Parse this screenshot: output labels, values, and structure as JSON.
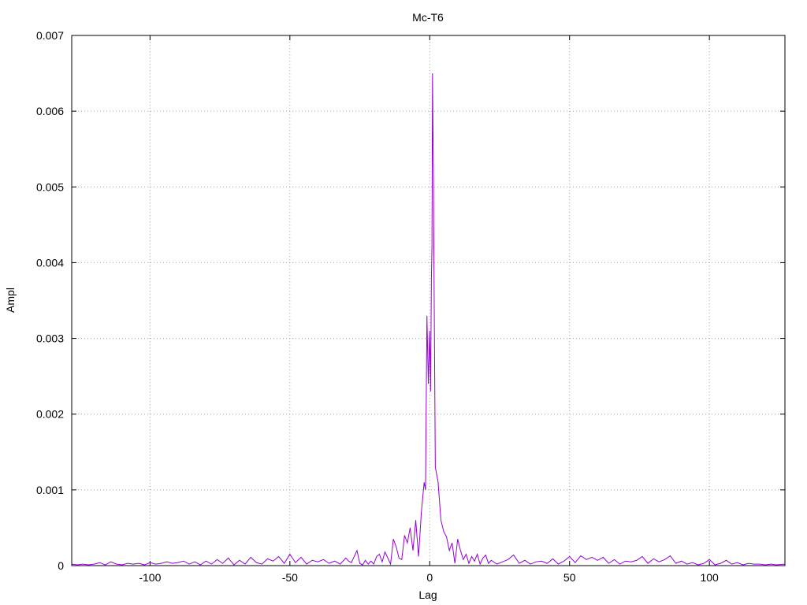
{
  "chart_data": {
    "type": "line",
    "title": "Mc-T6",
    "xlabel": "Lag",
    "ylabel": "Ampl",
    "xlim": [
      -128,
      127
    ],
    "ylim": [
      0,
      0.007
    ],
    "xticks": [
      -100,
      -50,
      0,
      50,
      100
    ],
    "xtick_labels": [
      "-100",
      "-50",
      "0",
      "50",
      "100"
    ],
    "yticks": [
      0,
      0.001,
      0.002,
      0.003,
      0.004,
      0.005,
      0.006,
      0.007
    ],
    "ytick_labels": [
      "0",
      "0.001",
      "0.002",
      "0.003",
      "0.004",
      "0.005",
      "0.006",
      "0.007"
    ],
    "grid": true,
    "legend": "none",
    "series": [
      {
        "color": "#9400d3",
        "points": [
          [
            -128,
            2e-05
          ],
          [
            -126,
            1e-05
          ],
          [
            -124,
            2e-05
          ],
          [
            -122,
            1e-05
          ],
          [
            -120,
            2e-05
          ],
          [
            -118,
            4e-05
          ],
          [
            -116,
            1e-05
          ],
          [
            -114,
            5e-05
          ],
          [
            -112,
            2e-05
          ],
          [
            -110,
            1e-05
          ],
          [
            -108,
            3e-05
          ],
          [
            -106,
            2e-05
          ],
          [
            -104,
            3e-05
          ],
          [
            -102,
            1e-05
          ],
          [
            -100,
            4e-05
          ],
          [
            -98,
            2e-05
          ],
          [
            -96,
            3e-05
          ],
          [
            -94,
            5e-05
          ],
          [
            -92,
            3e-05
          ],
          [
            -90,
            4e-05
          ],
          [
            -88,
            6e-05
          ],
          [
            -86,
            2e-05
          ],
          [
            -84,
            5e-05
          ],
          [
            -82,
            1e-05
          ],
          [
            -80,
            6e-05
          ],
          [
            -78,
            2e-05
          ],
          [
            -76,
            8e-05
          ],
          [
            -74,
            3e-05
          ],
          [
            -72,
            0.0001
          ],
          [
            -70,
            1e-05
          ],
          [
            -68,
            7e-05
          ],
          [
            -66,
            2e-05
          ],
          [
            -64,
            0.00011
          ],
          [
            -62,
            4e-05
          ],
          [
            -60,
            2e-05
          ],
          [
            -58,
            9e-05
          ],
          [
            -56,
            6e-05
          ],
          [
            -54,
            0.00012
          ],
          [
            -52,
            3e-05
          ],
          [
            -50,
            0.00015
          ],
          [
            -48,
            4e-05
          ],
          [
            -46,
            0.00011
          ],
          [
            -44,
            2e-05
          ],
          [
            -42,
            7e-05
          ],
          [
            -40,
            5e-05
          ],
          [
            -38,
            8e-05
          ],
          [
            -36,
            3e-05
          ],
          [
            -34,
            6e-05
          ],
          [
            -32,
            2e-05
          ],
          [
            -30,
            0.0001
          ],
          [
            -29,
            6e-05
          ],
          [
            -28,
            4e-05
          ],
          [
            -27,
            0.00012
          ],
          [
            -26,
            0.0002
          ],
          [
            -25,
            3e-05
          ],
          [
            -24,
            1e-05
          ],
          [
            -23,
            7e-05
          ],
          [
            -22,
            2e-05
          ],
          [
            -21,
            6e-05
          ],
          [
            -20,
            2e-05
          ],
          [
            -19,
            0.00012
          ],
          [
            -18,
            0.00015
          ],
          [
            -17,
            5e-05
          ],
          [
            -16,
            0.00018
          ],
          [
            -15,
            0.0001
          ],
          [
            -14,
            2e-05
          ],
          [
            -13,
            0.00035
          ],
          [
            -12,
            0.00025
          ],
          [
            -11,
            0.0001
          ],
          [
            -10,
            8e-05
          ],
          [
            -9,
            0.0004
          ],
          [
            -8,
            0.0003
          ],
          [
            -7,
            0.0005
          ],
          [
            -6,
            0.0002
          ],
          [
            -5,
            0.0006
          ],
          [
            -4,
            0.00012
          ],
          [
            -3,
            0.0007
          ],
          [
            -2,
            0.0011
          ],
          [
            -1.5,
            0.001
          ],
          [
            -1,
            0.0033
          ],
          [
            -0.5,
            0.0024
          ],
          [
            0,
            0.0031
          ],
          [
            0.3,
            0.0023
          ],
          [
            0.6,
            0.0038
          ],
          [
            0.8,
            0.0042
          ],
          [
            1,
            0.0065
          ],
          [
            1.3,
            0.0052
          ],
          [
            1.6,
            0.0035
          ],
          [
            2,
            0.0013
          ],
          [
            3,
            0.0011
          ],
          [
            4,
            0.0006
          ],
          [
            5,
            0.00045
          ],
          [
            6,
            0.00038
          ],
          [
            7,
            0.0002
          ],
          [
            8,
            0.0003
          ],
          [
            9,
            3e-05
          ],
          [
            10,
            0.00035
          ],
          [
            11,
            0.0002
          ],
          [
            12,
            8e-05
          ],
          [
            13,
            0.00015
          ],
          [
            14,
            3e-05
          ],
          [
            15,
            0.00012
          ],
          [
            16,
            6e-05
          ],
          [
            17,
            0.00015
          ],
          [
            18,
            2e-05
          ],
          [
            19,
            0.0001
          ],
          [
            20,
            0.00014
          ],
          [
            21,
            3e-05
          ],
          [
            22,
            7e-05
          ],
          [
            24,
            2e-05
          ],
          [
            26,
            5e-05
          ],
          [
            28,
            8e-05
          ],
          [
            30,
            0.00014
          ],
          [
            32,
            3e-05
          ],
          [
            34,
            7e-05
          ],
          [
            36,
            2e-05
          ],
          [
            38,
            5e-05
          ],
          [
            40,
            6e-05
          ],
          [
            42,
            3e-05
          ],
          [
            44,
            9e-05
          ],
          [
            46,
            2e-05
          ],
          [
            48,
            6e-05
          ],
          [
            50,
            0.00012
          ],
          [
            52,
            4e-05
          ],
          [
            54,
            0.00013
          ],
          [
            56,
            8e-05
          ],
          [
            58,
            0.00011
          ],
          [
            60,
            7e-05
          ],
          [
            62,
            0.00011
          ],
          [
            64,
            3e-05
          ],
          [
            66,
            8e-05
          ],
          [
            68,
            2e-05
          ],
          [
            70,
            6e-05
          ],
          [
            72,
            5e-05
          ],
          [
            74,
            7e-05
          ],
          [
            76,
            0.00012
          ],
          [
            78,
            3e-05
          ],
          [
            80,
            9e-05
          ],
          [
            82,
            5e-05
          ],
          [
            84,
            8e-05
          ],
          [
            86,
            0.00013
          ],
          [
            88,
            3e-05
          ],
          [
            90,
            6e-05
          ],
          [
            92,
            2e-05
          ],
          [
            94,
            4e-05
          ],
          [
            96,
            1e-05
          ],
          [
            98,
            3e-05
          ],
          [
            100,
            8e-05
          ],
          [
            102,
            1e-05
          ],
          [
            104,
            3e-05
          ],
          [
            106,
            7e-05
          ],
          [
            108,
            2e-05
          ],
          [
            110,
            4e-05
          ],
          [
            112,
            1e-05
          ],
          [
            114,
            3e-05
          ],
          [
            116,
            2e-05
          ],
          [
            118,
            2e-05
          ],
          [
            120,
            1e-05
          ],
          [
            122,
            2e-05
          ],
          [
            124,
            1e-05
          ],
          [
            127,
            2e-05
          ]
        ]
      }
    ]
  }
}
